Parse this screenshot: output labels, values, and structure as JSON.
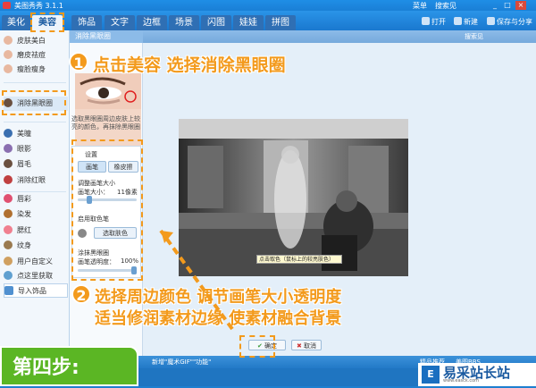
{
  "app": {
    "title": "美图秀秀 3.1.1",
    "menu": "菜单",
    "user": "搜索见"
  },
  "tabs": [
    "美化",
    "美容",
    "饰品",
    "文字",
    "边框",
    "场景",
    "闪图",
    "娃娃",
    "拼图"
  ],
  "active_tab": "美容",
  "toolbar": {
    "open": "打开",
    "new": "新建",
    "save": "保存与分享"
  },
  "sidebar": {
    "items": [
      "皮肤美白",
      "磨皮祛痘",
      "瘦脸瘦身",
      "消除黑眼圈",
      "美瞳",
      "眼影",
      "眉毛",
      "消除红眼",
      "唇彩",
      "染发",
      "腮红",
      "纹身",
      "用户自定义",
      "点这里获取",
      "导入饰品"
    ]
  },
  "panel": {
    "title": "消除黑眼圈",
    "description": "选取黑眼圈周边皮肤上较亮的颜色，再抹除黑眼圈",
    "settings_title": "设置",
    "mode_paint": "画笔",
    "mode_erase": "橡皮擦",
    "step1": "调整画笔大小",
    "brush_size_label": "画笔大小：",
    "brush_size_value": "11像素",
    "step2": "启用取色笔",
    "pick_color_button": "选取肤色",
    "step3": "涂抹黑眼圈",
    "opacity_label": "画笔透明度：",
    "opacity_value": "100%"
  },
  "main": {
    "help": "搜索见"
  },
  "canvas": {
    "tooltip": "点击取色（鼠标上的较亮肤色）"
  },
  "buttons": {
    "ok": "确定",
    "cancel": "取消"
  },
  "statusbar": {
    "left": "新增\"魔术GIF\"\"功能\"",
    "right1": "精品推荐",
    "right2": "美图BBS"
  },
  "annotations": {
    "step1_num": "1",
    "step1_text": "点击美容 选择消除黑眼圈",
    "step2_num": "2",
    "step2_line1": "选择周边颜色 调节画笔大小透明度",
    "step2_line2": "适当修润素材边缘 使素材融合背景",
    "step_label": "第四步:"
  },
  "logo": {
    "mark": "E",
    "name": "易采站长站",
    "sub": "www.easck.com"
  },
  "colors": {
    "accent": "#f39a1c",
    "blue": "#1e7fd0",
    "green": "#5bb624"
  }
}
